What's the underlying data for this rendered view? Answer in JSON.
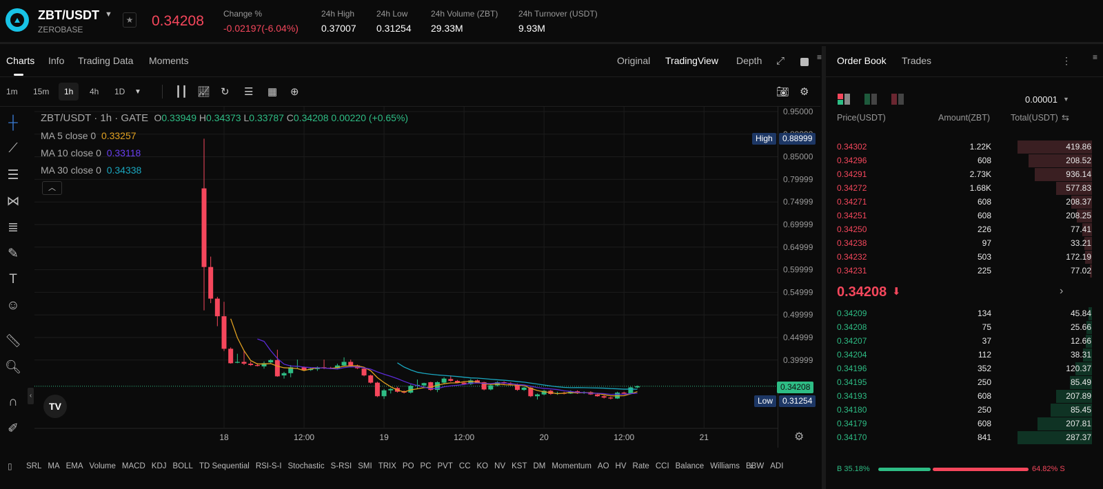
{
  "header": {
    "pair": "ZBT/USDT",
    "name": "ZEROBASE",
    "last_price": "0.34208",
    "stats": [
      {
        "label": "Change %",
        "value": "-0.02197(-6.04%)",
        "neg": true
      },
      {
        "label": "24h High",
        "value": "0.37007"
      },
      {
        "label": "24h Low",
        "value": "0.31254"
      },
      {
        "label": "24h Volume (ZBT)",
        "value": "29.33M"
      },
      {
        "label": "24h Turnover (USDT)",
        "value": "9.93M"
      }
    ]
  },
  "tabs": [
    "Charts",
    "Info",
    "Trading Data",
    "Moments"
  ],
  "views": [
    "Original",
    "TradingView",
    "Depth"
  ],
  "timeframes": [
    "1m",
    "15m",
    "1h",
    "4h",
    "1D"
  ],
  "legend": {
    "title": "ZBT/USDT · 1h · GATE",
    "o": "0.33949",
    "h": "0.34373",
    "l": "0.33787",
    "c": "0.34208",
    "chg": "0.00220 (+0.65%)",
    "ma5": {
      "label": "MA 5 close 0",
      "value": "0.33257"
    },
    "ma10": {
      "label": "MA 10 close 0",
      "value": "0.33118"
    },
    "ma30": {
      "label": "MA 30 close 0",
      "value": "0.34338"
    }
  },
  "colors": {
    "up": "#2ebd85",
    "down": "#f5475c",
    "ma5": "#e0a020",
    "ma10": "#5b2bd6",
    "ma30": "#1aa7c0"
  },
  "chart_data": {
    "type": "candlestick",
    "interval": "1h",
    "ylim": [
      0.29,
      0.95
    ],
    "price_ticks": [
      "0.95000",
      "0.89999",
      "0.85000",
      "0.79999",
      "0.74999",
      "0.69999",
      "0.64999",
      "0.59999",
      "0.54999",
      "0.49999",
      "0.44999",
      "0.39999"
    ],
    "time_ticks": [
      {
        "label": "18",
        "hour": 3
      },
      {
        "label": "12:00",
        "hour": 15
      },
      {
        "label": "19",
        "hour": 27
      },
      {
        "label": "12:00",
        "hour": 39
      },
      {
        "label": "20",
        "hour": 51
      },
      {
        "label": "12:00",
        "hour": 63
      },
      {
        "label": "21",
        "hour": 75
      }
    ],
    "high": {
      "label": "High",
      "value": "0.88999"
    },
    "low": {
      "label": "Low",
      "value": "0.31254"
    },
    "current": "0.34208",
    "ohlc": [
      [
        0.78,
        0.89,
        0.51,
        0.606
      ],
      [
        0.606,
        0.629,
        0.526,
        0.536
      ],
      [
        0.536,
        0.54,
        0.475,
        0.497
      ],
      [
        0.497,
        0.529,
        0.42,
        0.425
      ],
      [
        0.425,
        0.428,
        0.392,
        0.393
      ],
      [
        0.394,
        0.414,
        0.393,
        0.396
      ],
      [
        0.396,
        0.422,
        0.389,
        0.392
      ],
      [
        0.392,
        0.397,
        0.387,
        0.389
      ],
      [
        0.389,
        0.393,
        0.386,
        0.387
      ],
      [
        0.386,
        0.397,
        0.381,
        0.393
      ],
      [
        0.395,
        0.402,
        0.392,
        0.4
      ],
      [
        0.4,
        0.423,
        0.363,
        0.364
      ],
      [
        0.366,
        0.374,
        0.359,
        0.371
      ],
      [
        0.371,
        0.389,
        0.362,
        0.384
      ],
      [
        0.386,
        0.401,
        0.382,
        0.387
      ],
      [
        0.384,
        0.386,
        0.376,
        0.378
      ],
      [
        0.378,
        0.383,
        0.376,
        0.381
      ],
      [
        0.38,
        0.386,
        0.376,
        0.384
      ],
      [
        0.384,
        0.401,
        0.38,
        0.382
      ],
      [
        0.383,
        0.385,
        0.38,
        0.382
      ],
      [
        0.382,
        0.392,
        0.38,
        0.388
      ],
      [
        0.388,
        0.406,
        0.386,
        0.396
      ],
      [
        0.396,
        0.401,
        0.384,
        0.388
      ],
      [
        0.388,
        0.39,
        0.38,
        0.382
      ],
      [
        0.381,
        0.383,
        0.364,
        0.366
      ],
      [
        0.366,
        0.368,
        0.348,
        0.35
      ],
      [
        0.35,
        0.352,
        0.318,
        0.32
      ],
      [
        0.32,
        0.336,
        0.314,
        0.333
      ],
      [
        0.333,
        0.338,
        0.326,
        0.336
      ],
      [
        0.338,
        0.341,
        0.328,
        0.33
      ],
      [
        0.331,
        0.333,
        0.326,
        0.328
      ],
      [
        0.328,
        0.346,
        0.326,
        0.343
      ],
      [
        0.343,
        0.357,
        0.337,
        0.345
      ],
      [
        0.344,
        0.35,
        0.338,
        0.349
      ],
      [
        0.351,
        0.352,
        0.332,
        0.334
      ],
      [
        0.334,
        0.353,
        0.329,
        0.351
      ],
      [
        0.35,
        0.362,
        0.346,
        0.359
      ],
      [
        0.358,
        0.366,
        0.352,
        0.354
      ],
      [
        0.354,
        0.356,
        0.349,
        0.35
      ],
      [
        0.35,
        0.352,
        0.346,
        0.347
      ],
      [
        0.347,
        0.358,
        0.345,
        0.355
      ],
      [
        0.355,
        0.357,
        0.349,
        0.35
      ],
      [
        0.351,
        0.352,
        0.333,
        0.335
      ],
      [
        0.335,
        0.347,
        0.333,
        0.344
      ],
      [
        0.344,
        0.353,
        0.342,
        0.351
      ],
      [
        0.351,
        0.353,
        0.346,
        0.348
      ],
      [
        0.348,
        0.351,
        0.344,
        0.346
      ],
      [
        0.346,
        0.348,
        0.332,
        0.334
      ],
      [
        0.334,
        0.341,
        0.332,
        0.339
      ],
      [
        0.339,
        0.341,
        0.318,
        0.32
      ],
      [
        0.32,
        0.326,
        0.31254,
        0.324
      ],
      [
        0.324,
        0.334,
        0.322,
        0.332
      ],
      [
        0.332,
        0.334,
        0.323,
        0.325
      ],
      [
        0.325,
        0.33,
        0.323,
        0.327
      ],
      [
        0.327,
        0.33,
        0.324,
        0.326
      ],
      [
        0.326,
        0.333,
        0.325,
        0.331
      ],
      [
        0.331,
        0.333,
        0.325,
        0.327
      ],
      [
        0.327,
        0.331,
        0.325,
        0.329
      ],
      [
        0.329,
        0.331,
        0.323,
        0.324
      ],
      [
        0.324,
        0.326,
        0.319,
        0.32
      ],
      [
        0.32,
        0.322,
        0.315,
        0.317
      ],
      [
        0.317,
        0.319,
        0.313,
        0.315
      ],
      [
        0.315,
        0.33,
        0.314,
        0.328
      ],
      [
        0.328,
        0.33,
        0.325,
        0.326
      ],
      [
        0.326,
        0.341,
        0.325,
        0.3395
      ],
      [
        0.33949,
        0.34373,
        0.33787,
        0.34208
      ]
    ]
  },
  "indicators": [
    "SRL",
    "MA",
    "EMA",
    "Volume",
    "MACD",
    "KDJ",
    "BOLL",
    "TD Sequential",
    "RSI-S-I",
    "Stochastic",
    "S-RSI",
    "SMI",
    "TRIX",
    "PO",
    "PC",
    "PVT",
    "CC",
    "KO",
    "NV",
    "KST",
    "DM",
    "Momentum",
    "AO",
    "HV",
    "Rate",
    "CCI",
    "Balance",
    "Williams",
    "BBW",
    "ADI"
  ],
  "orderbook": {
    "tabs": [
      "Order Book",
      "Trades"
    ],
    "precision": "0.00001",
    "headers": [
      "Price(USDT)",
      "Amount(ZBT)",
      "Total(USDT)"
    ],
    "asks": [
      {
        "p": "0.34302",
        "a": "1.22K",
        "t": "419.86",
        "d": 1.0
      },
      {
        "p": "0.34296",
        "a": "608",
        "t": "208.52",
        "d": 0.85
      },
      {
        "p": "0.34291",
        "a": "2.73K",
        "t": "936.14",
        "d": 0.77
      },
      {
        "p": "0.34272",
        "a": "1.68K",
        "t": "577.83",
        "d": 0.48
      },
      {
        "p": "0.34271",
        "a": "608",
        "t": "208.37",
        "d": 0.28
      },
      {
        "p": "0.34251",
        "a": "608",
        "t": "208.25",
        "d": 0.2
      },
      {
        "p": "0.34250",
        "a": "226",
        "t": "77.41",
        "d": 0.13
      },
      {
        "p": "0.34238",
        "a": "97",
        "t": "33.21",
        "d": 0.1
      },
      {
        "p": "0.34232",
        "a": "503",
        "t": "172.19",
        "d": 0.09
      },
      {
        "p": "0.34231",
        "a": "225",
        "t": "77.02",
        "d": 0.03
      }
    ],
    "mid": "0.34208",
    "bids": [
      {
        "p": "0.34209",
        "a": "134",
        "t": "45.84",
        "d": 0.05
      },
      {
        "p": "0.34208",
        "a": "75",
        "t": "25.66",
        "d": 0.07
      },
      {
        "p": "0.34207",
        "a": "37",
        "t": "12.66",
        "d": 0.08
      },
      {
        "p": "0.34204",
        "a": "112",
        "t": "38.31",
        "d": 0.12
      },
      {
        "p": "0.34196",
        "a": "352",
        "t": "120.37",
        "d": 0.22
      },
      {
        "p": "0.34195",
        "a": "250",
        "t": "85.49",
        "d": 0.3
      },
      {
        "p": "0.34193",
        "a": "608",
        "t": "207.89",
        "d": 0.48
      },
      {
        "p": "0.34180",
        "a": "250",
        "t": "85.45",
        "d": 0.56
      },
      {
        "p": "0.34179",
        "a": "608",
        "t": "207.81",
        "d": 0.73
      },
      {
        "p": "0.34170",
        "a": "841",
        "t": "287.37",
        "d": 1.0
      }
    ],
    "buy_ratio": "B 35.18%",
    "sell_ratio": "64.82% S",
    "buy_fraction": 0.3518
  }
}
